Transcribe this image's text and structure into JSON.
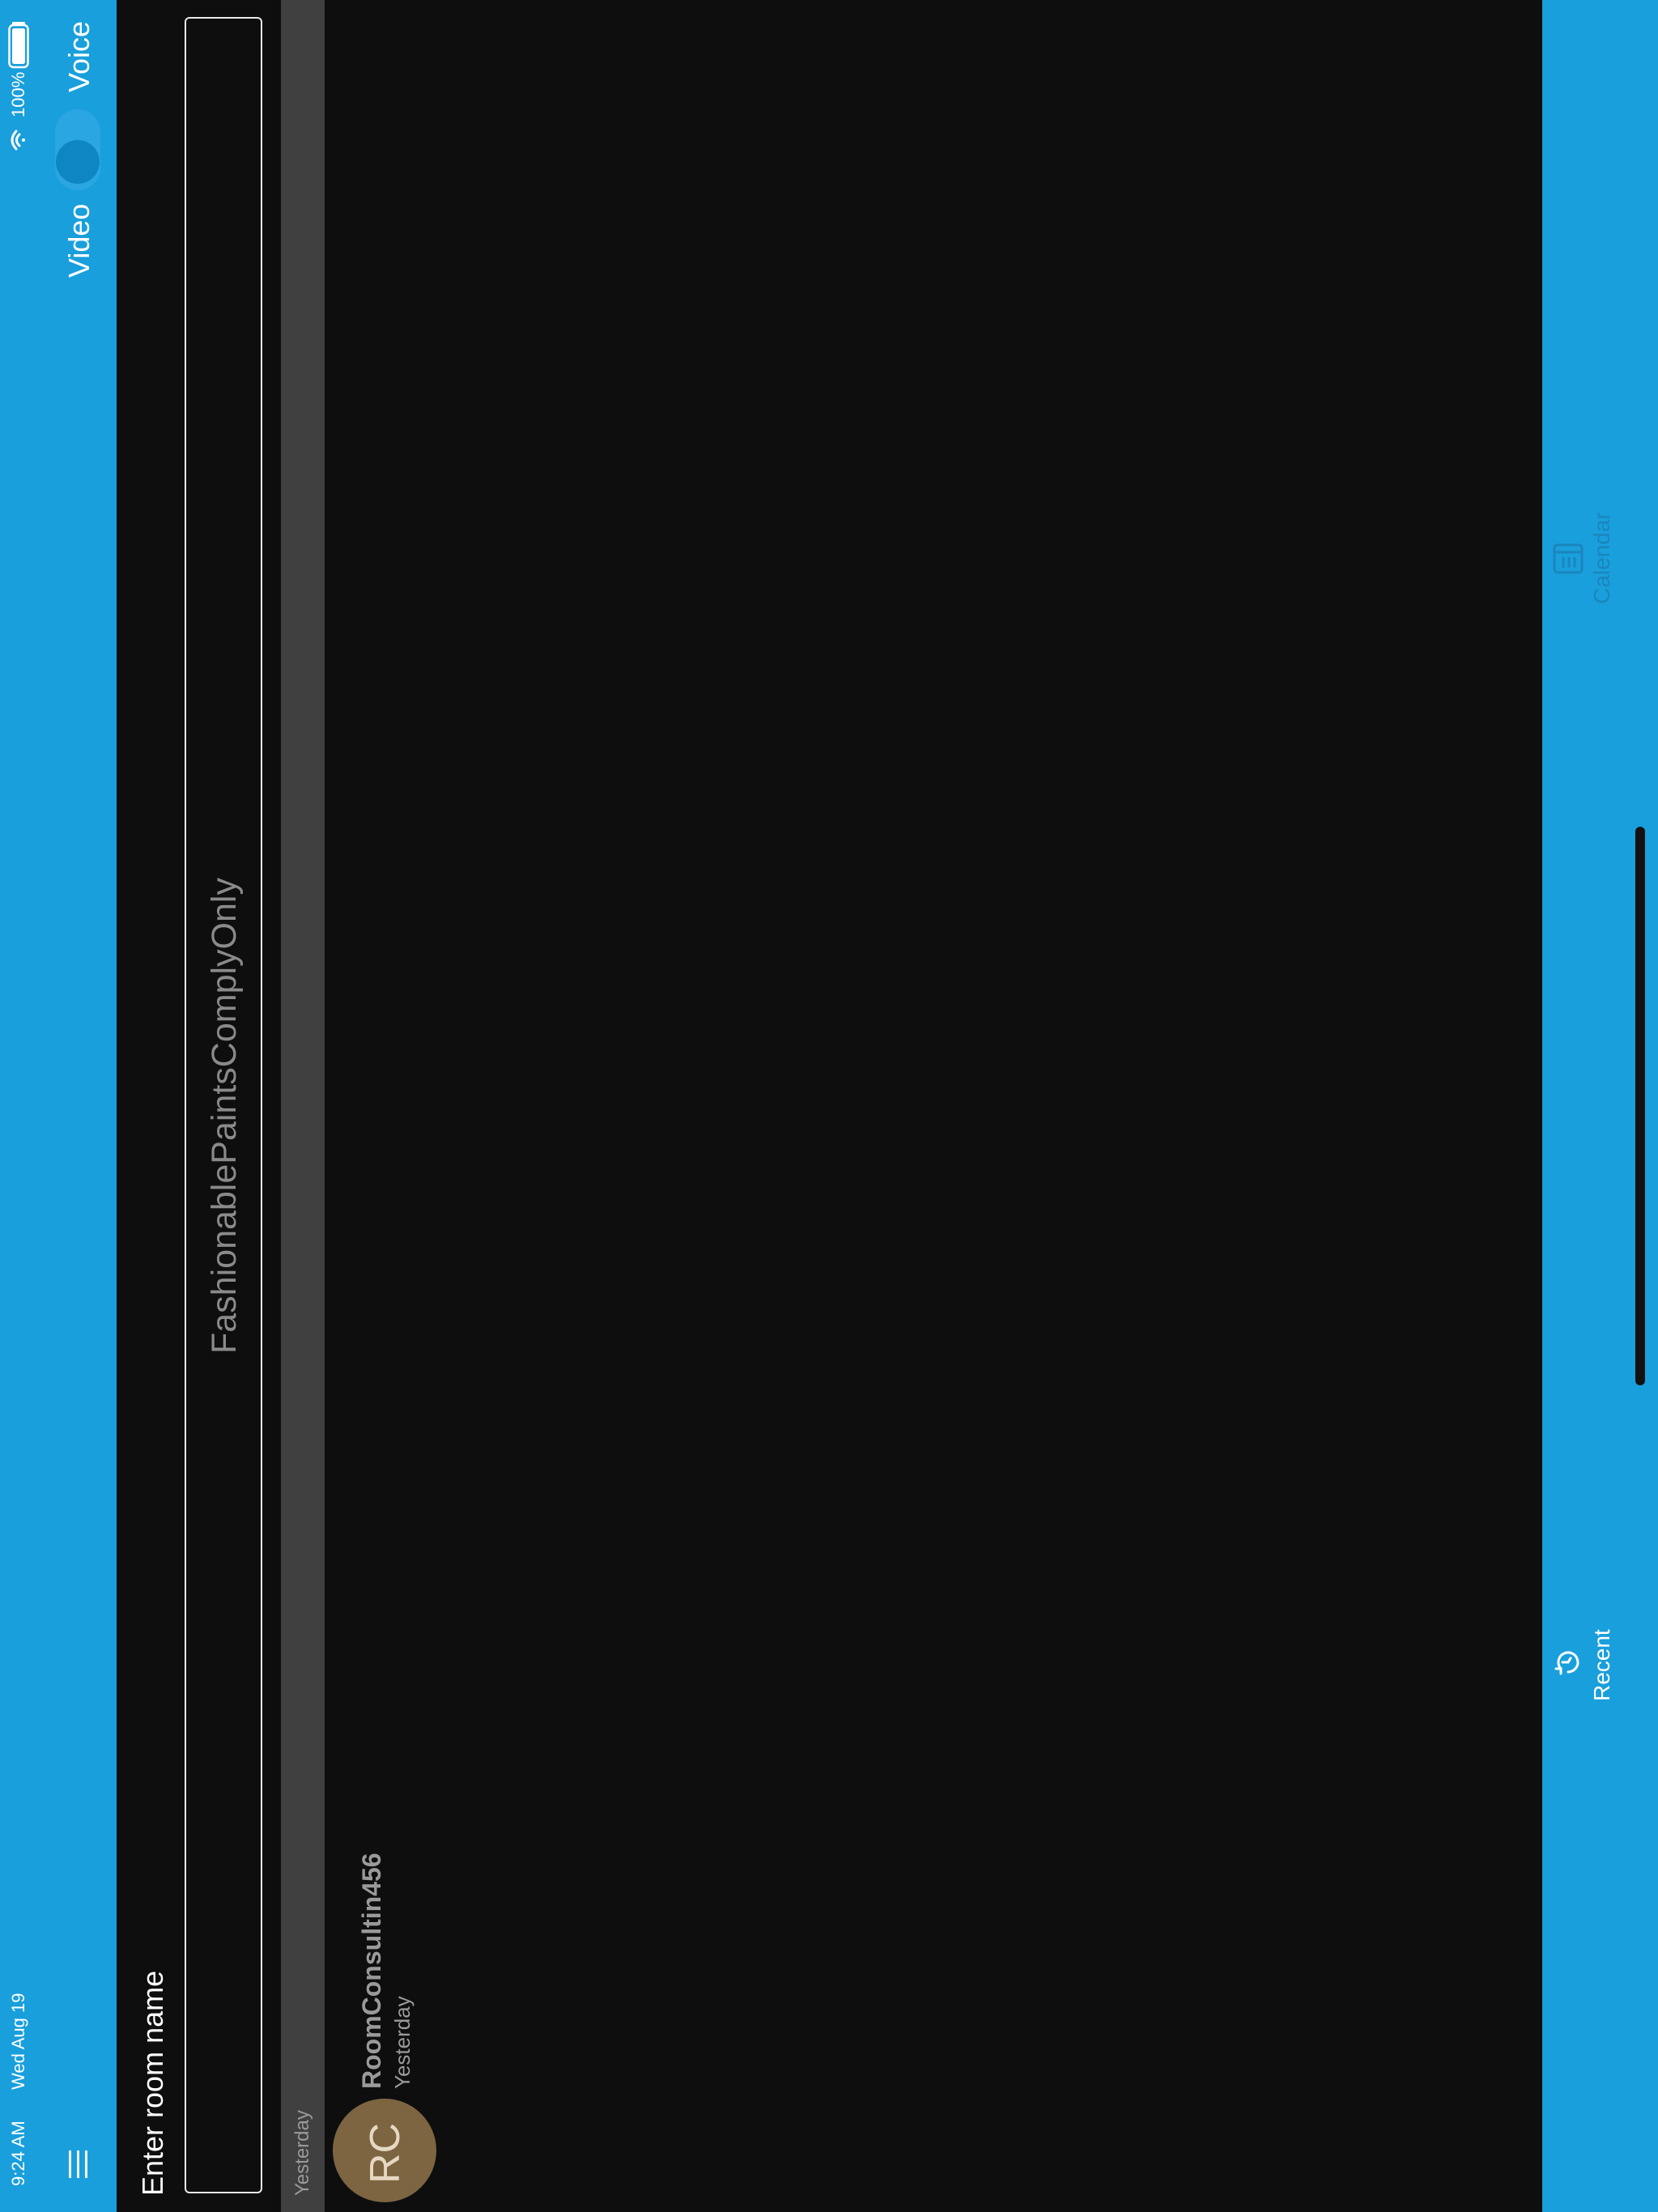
{
  "status_bar": {
    "time": "9:24 AM",
    "date": "Wed Aug 19",
    "battery": "100%"
  },
  "header": {
    "mode_left": "Video",
    "mode_right": "Voice",
    "menu_icon": "hamburger-icon"
  },
  "room_entry": {
    "label": "Enter room name",
    "value": "FashionablePaintsComplyOnly"
  },
  "recent": {
    "section_label": "Yesterday",
    "items": [
      {
        "initials": "RC",
        "name": "RoomConsultin456",
        "when": "Yesterday"
      }
    ]
  },
  "tabs": {
    "recent": "Recent",
    "calendar": "Calendar"
  },
  "colors": {
    "accent": "#199fdc",
    "background": "#0e0e0e",
    "avatar": "#7d6542"
  }
}
